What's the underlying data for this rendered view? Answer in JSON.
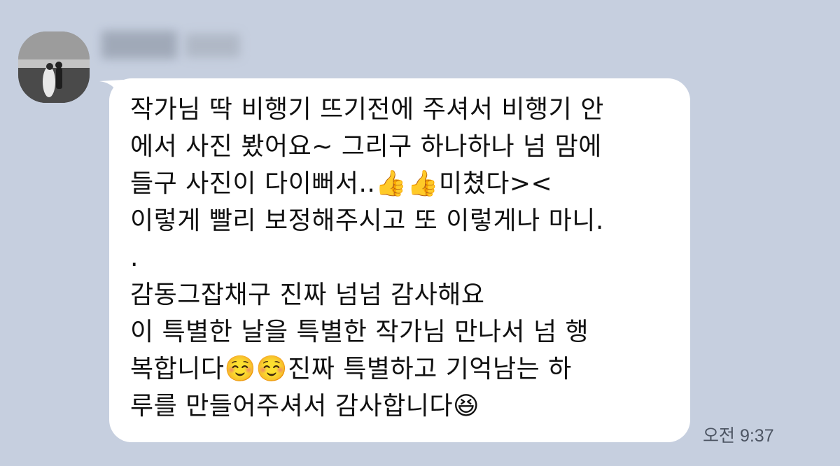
{
  "chat": {
    "sender": {
      "name": "",
      "avatar": "profile-photo-couple-beach"
    },
    "message": {
      "text": "작가님 딱 비행기 뜨기전에 주셔서 비행기 안\n에서 사진 봤어요~ 그리구 하나하나 넘 맘에\n들구 사진이 다이뻐서..👍👍미쳤다><\n이렇게 빨리 보정해주시고 또 이렇게나 마니.\n.\n감동그잡채구 진짜 넘넘 감사해요\n이 특별한 날을 특별한 작가님 만나서 넘 행\n복합니다☺️☺️진짜 특별하고 기억남는 하\n루를 만들어주셔서 감사합니다😆",
      "time": "오전 9:37"
    }
  },
  "colors": {
    "background": "#c6cfdf",
    "bubble": "#ffffff",
    "text": "#111111",
    "timestamp": "#4d5563"
  }
}
